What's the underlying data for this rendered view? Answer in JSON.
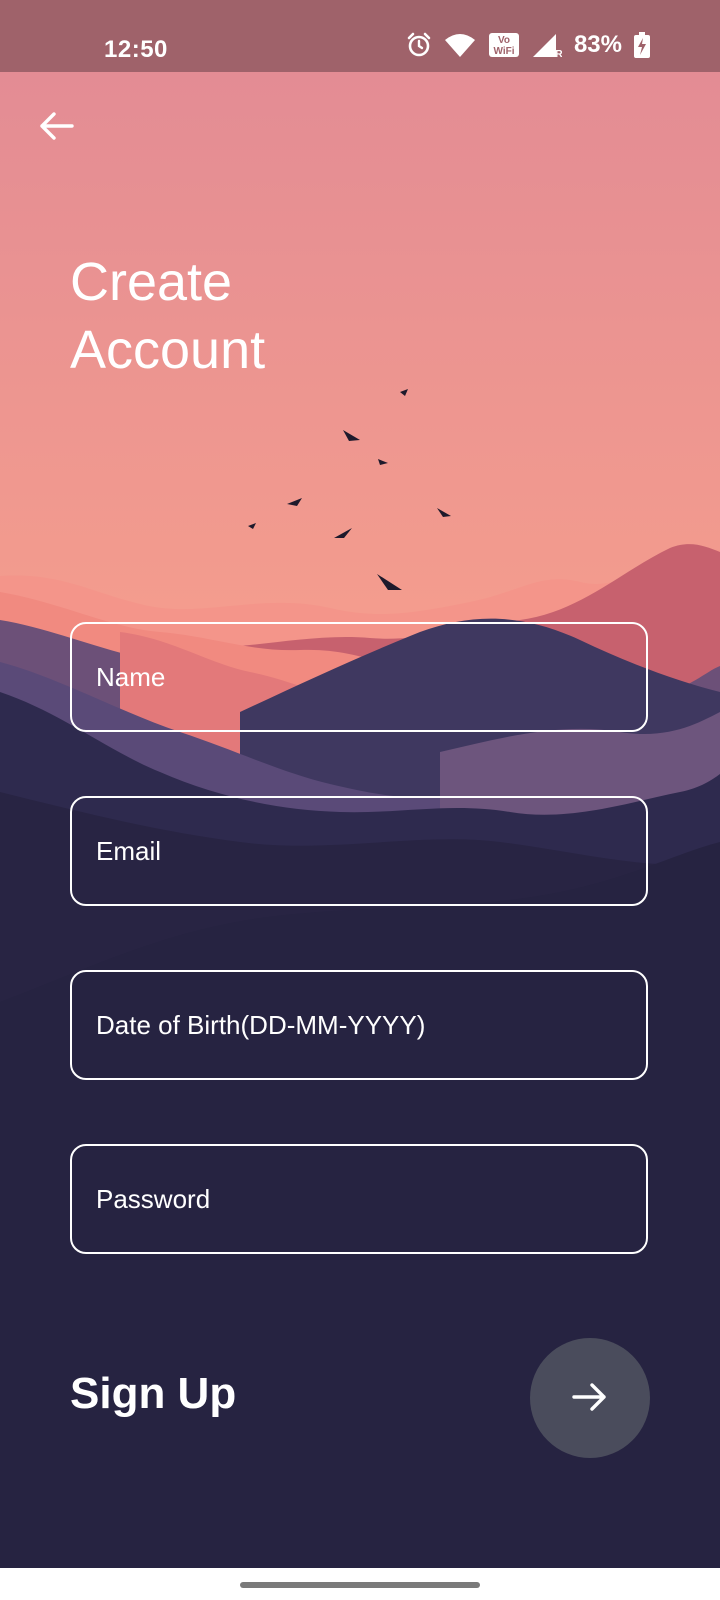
{
  "status_bar": {
    "time": "12:50",
    "battery_percent": "83%",
    "vowifi_label_top": "Vo",
    "vowifi_label_bottom": "WiFi",
    "signal_label": "R",
    "icons": [
      "alarm-icon",
      "wifi-icon",
      "vowifi-icon",
      "signal-icon",
      "battery-charging-icon"
    ]
  },
  "header": {
    "back_icon": "arrow-left-icon"
  },
  "page": {
    "title_line1": "Create",
    "title_line2": "Account"
  },
  "form": {
    "name_placeholder": "Name",
    "email_placeholder": "Email",
    "dob_placeholder": "Date of Birth(DD-MM-YYYY)",
    "password_placeholder": "Password",
    "signup_label": "Sign Up",
    "submit_icon": "arrow-right-icon"
  },
  "colors": {
    "status_bar": "#9f626a",
    "sky_top": "#e38c94",
    "sky_bottom": "#fbb496",
    "mountain_dark": "#262341",
    "submit_button": "#4a4c5c",
    "text": "#ffffff"
  }
}
